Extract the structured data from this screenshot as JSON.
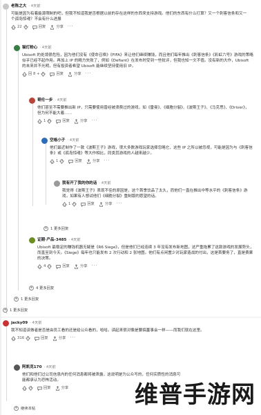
{
  "colors": {
    "upvote": "#ff4500",
    "accent": "#0079d3"
  },
  "comments": [
    {
      "user": "老陈之大",
      "time": "· 4天前",
      "body": "可能是因为有着能源限制的吧，但我不知道我是否根据以前的存在这样的东西来支持游戏。他们的东西有什么打算？又一个刺客信条和又一个孤岛惊魂？不会有什么进展",
      "votes": "22",
      "reply": "回复",
      "share": "分享",
      "avatar_color": "#c8c8c8"
    },
    {
      "user": "猫灯粉心",
      "time": "· 4天前",
      "body": "Ubisoft 的处境很危险，因为他们没有《使命召唤》《FIFA》来让他们继续赚钱，而且他们每年推出《刺客信条》《彩虹六号》游戏的策略似乎已经不起作用。再加上 IP 的精力失败了，例如《Defiant》在发布时受到一些批评，但我也知一文不值。没有新的大作，Ubisoft 的未来并不光明，但有投资者希望 Ubisoft 能继续坚持使用旧 IP。",
      "votes": "回复",
      "reply": "回复",
      "share": "分享",
      "avatar_color": "#3a7d44",
      "votes_count": "回 8 +"
    },
    {
      "user": "哥伦一步",
      "time": "· 4天前",
      "body": "他们甚至不需要推出新 IP，只需要使用曾经被浪费过的游戏，如《雷曼》、《细胞分裂》、《波斯王子》、《马克思》、《Driver》，但为何不能大着……",
      "votes": "1",
      "reply": "回复",
      "share": "分享",
      "avatar_color": "#b8453a"
    },
    {
      "user": "空格小子",
      "time": "· 4天前",
      "body": "他们最近制作了一款《波斯王子》游戏，很大多数游戏玩家选择忽略它，这些 IP 之所以被忽视，可能是因为与《刺客信条》或《孤岛惊魂》等大作相比，同类其游戏的人越来越少。",
      "votes": "1",
      "reply": "回复",
      "share": "分享",
      "avatar_color": "#2d6cb8"
    },
    {
      "user": "我有开了我的你的话",
      "time": "· 4天前",
      "body": "我觉得《波斯王子》表现不佳的原因是，这个首季饮品了太久，而他们一直在推出中等水平的《刺客信条》游戏，如果有人想试他们《细胞分裂》重制版的愿望的话。",
      "votes": "1",
      "reply": "回复",
      "share": "分享",
      "avatar_color": "#9a9a9a"
    },
    {
      "user": "证期·产品-3485",
      "time": "· 4天前",
      "body": "Ubisoft 最稳定的赚钱机器无疑是《R6 Siege》，但是他们已经连续 3 年没有发布新地图，这严重拖累了这款游戏的发展势头，而直至到今天。《Siege》每年也只能发布 2 次行动和 2 张地图。他们有点闲置少对玩家造战的付出，这是首要务了，直是费果的决策。",
      "votes": "4",
      "reply": "回复",
      "share": "分享",
      "avatar_color": "#6b8e23"
    },
    {
      "user": "jacky09",
      "time": "· 4天前",
      "body": "我不知道该做者是否是由员工看的还是给公众看的，哈哈。读起来很对像是要搞董事会一样——而我们就在这里。",
      "votes": "316",
      "reply": "回复",
      "share": "分享",
      "avatar_color": "#c83232"
    },
    {
      "user": "阿凯克170",
      "time": "· 4天前",
      "body": "他们和他们过公司信息内的任何消息都将被泄露，这说明是为公众写的，任何实质性的消息可能都承认为恐怖活动。",
      "votes": "",
      "reply": "回复",
      "share": "分享",
      "avatar_color": "#555555"
    }
  ],
  "more_replies": [
    "1 更多回复",
    "4 更多回复",
    "1 更多回复",
    "1 更多回复"
  ],
  "footer_more": "继续本帖",
  "watermark": "维普手游网"
}
